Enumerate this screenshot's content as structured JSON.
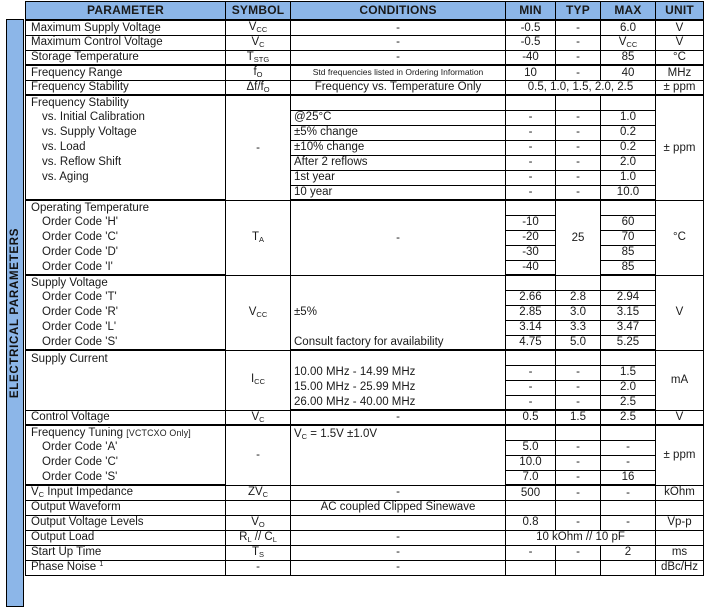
{
  "banner": {
    "label": "ELECTRICAL PARAMETERS"
  },
  "colors": {
    "header_fill": "#8cb6e8",
    "banner_fill": "#8cb6e8",
    "border": "#000000",
    "text": "#1a1a1a"
  },
  "columns": {
    "parameter": "PARAMETER",
    "symbol": "SYMBOL",
    "conditions": "CONDITIONS",
    "min": "MIN",
    "typ": "TYP",
    "max": "MAX",
    "unit": "UNIT"
  },
  "rows": {
    "max_supply_voltage": {
      "parameter": "Maximum Supply Voltage",
      "symbol_base": "V",
      "symbol_sub": "CC",
      "conditions": "-",
      "min": "-0.5",
      "typ": "-",
      "max": "6.0",
      "unit": "V"
    },
    "max_control_voltage": {
      "parameter": "Maximum Control Voltage",
      "symbol_base": "V",
      "symbol_sub": "C",
      "conditions": "-",
      "min": "-0.5",
      "typ": "-",
      "max_base": "V",
      "max_sub": "CC",
      "unit": "V"
    },
    "storage_temperature": {
      "parameter": "Storage Temperature",
      "symbol_base": "T",
      "symbol_sub": "STG",
      "conditions": "-",
      "min": "-40",
      "typ": "-",
      "max": "85",
      "unit": "°C"
    },
    "frequency_range": {
      "parameter": "Frequency Range",
      "symbol_base": "f",
      "symbol_sub": "O",
      "conditions": "Std frequencies listed in Ordering Information",
      "min": "10",
      "typ": "-",
      "max": "40",
      "unit": "MHz"
    },
    "frequency_stability": {
      "parameter": "Frequency Stability",
      "symbol": "Δf/f",
      "symbol_sub": "O",
      "conditions": "Frequency vs. Temperature Only",
      "value": "0.5, 1.0, 1.5, 2.0, 2.5",
      "unit": "± ppm"
    },
    "fstab_group": {
      "title": "Frequency Stability",
      "symbol": "-",
      "unit": "± ppm",
      "items": [
        {
          "parameter": "vs. Initial Calibration",
          "conditions": "@25°C",
          "min": "-",
          "typ": "-",
          "max": "1.0"
        },
        {
          "parameter": "vs. Supply Voltage",
          "conditions": "±5% change",
          "min": "-",
          "typ": "-",
          "max": "0.2"
        },
        {
          "parameter": "vs. Load",
          "conditions": "±10% change",
          "min": "-",
          "typ": "-",
          "max": "0.2"
        },
        {
          "parameter": "vs. Reflow Shift",
          "conditions": "After 2 reflows",
          "min": "-",
          "typ": "-",
          "max": "2.0"
        },
        {
          "parameter": "vs. Aging",
          "conditions": "1st year",
          "min": "-",
          "typ": "-",
          "max": "1.0"
        },
        {
          "parameter": "",
          "conditions": "10 year",
          "min": "-",
          "typ": "-",
          "max": "10.0"
        }
      ]
    },
    "optemp_group": {
      "title": "Operating Temperature",
      "symbol_base": "T",
      "symbol_sub": "A",
      "conditions": "-",
      "typ": "25",
      "unit": "°C",
      "items": [
        {
          "parameter": "Order Code 'H'",
          "min": "-10",
          "max": "60"
        },
        {
          "parameter": "Order Code 'C'",
          "min": "-20",
          "max": "70"
        },
        {
          "parameter": "Order Code 'D'",
          "min": "-30",
          "max": "85"
        },
        {
          "parameter": "Order Code 'I'",
          "min": "-40",
          "max": "85"
        }
      ]
    },
    "supplyv_group": {
      "title": "Supply Voltage",
      "symbol_base": "V",
      "symbol_sub": "CC",
      "conditions_1": "±5%",
      "conditions_2": "Consult factory for availability",
      "unit": "V",
      "items": [
        {
          "parameter": "Order Code 'T'",
          "min": "2.66",
          "typ": "2.8",
          "max": "2.94"
        },
        {
          "parameter": "Order Code 'R'",
          "min": "2.85",
          "typ": "3.0",
          "max": "3.15"
        },
        {
          "parameter": "Order Code 'L'",
          "min": "3.14",
          "typ": "3.3",
          "max": "3.47"
        },
        {
          "parameter": "Order Code 'S'",
          "min": "4.75",
          "typ": "5.0",
          "max": "5.25"
        }
      ]
    },
    "supplyc_group": {
      "title": "Supply Current",
      "symbol_base": "I",
      "symbol_sub": "CC",
      "unit": "mA",
      "items": [
        {
          "conditions": "10.00 MHz - 14.99 MHz",
          "min": "-",
          "typ": "-",
          "max": "1.5"
        },
        {
          "conditions": "15.00 MHz - 25.99 MHz",
          "min": "-",
          "typ": "-",
          "max": "2.0"
        },
        {
          "conditions": "26.00 MHz - 40.00 MHz",
          "min": "-",
          "typ": "-",
          "max": "2.5"
        }
      ]
    },
    "control_voltage": {
      "parameter": "Control Voltage",
      "symbol_base": "V",
      "symbol_sub": "C",
      "conditions": "-",
      "min": "0.5",
      "typ": "1.5",
      "max": "2.5",
      "unit": "V"
    },
    "ftune_group": {
      "title": "Frequency Tuning",
      "title_note": "[VCTCXO Only]",
      "symbol": "-",
      "conditions_head_a": "V",
      "conditions_head_sub": "C",
      "conditions_head_b": " = 1.5V ±1.0V",
      "unit": "± ppm",
      "items": [
        {
          "parameter": "Order Code 'A'",
          "min": "5.0",
          "typ": "-",
          "max": "-"
        },
        {
          "parameter": "Order Code 'C'",
          "min": "10.0",
          "typ": "-",
          "max": "-"
        },
        {
          "parameter": "Order Code 'S'",
          "min": "7.0",
          "typ": "-",
          "max": "16"
        }
      ]
    },
    "vc_input_impedance": {
      "parameter_base": "V",
      "parameter_sub": "C",
      "parameter_rest": " Input Impedance",
      "symbol_base": "ZV",
      "symbol_sub": "C",
      "conditions": "-",
      "min": "500",
      "typ": "-",
      "max": "-",
      "unit": "kOhm"
    },
    "output_waveform": {
      "parameter": "Output Waveform",
      "symbol": "",
      "conditions": "AC coupled Clipped Sinewave",
      "min": "",
      "typ": "",
      "max": "",
      "unit": ""
    },
    "output_voltage": {
      "parameter": "Output Voltage Levels",
      "symbol_base": "V",
      "symbol_sub": "O",
      "conditions": "",
      "min": "0.8",
      "typ": "-",
      "max": "-",
      "unit": "Vp-p"
    },
    "output_load": {
      "parameter": "Output Load",
      "symbol_a": "R",
      "symbol_a_sub": "L",
      "symbol_mid": " // ",
      "symbol_b": "C",
      "symbol_b_sub": "L",
      "conditions": "-",
      "value": "10 kOhm // 10 pF",
      "unit": ""
    },
    "start_up_time": {
      "parameter": "Start Up Time",
      "symbol_base": "T",
      "symbol_sub": "S",
      "conditions": "-",
      "min": "-",
      "typ": "-",
      "max": "2",
      "unit": "ms"
    },
    "phase_noise": {
      "parameter": "Phase Noise",
      "footnote": "1",
      "symbol": "-",
      "conditions": "-",
      "min": "",
      "typ": "",
      "max": "",
      "unit": "dBc/Hz"
    }
  }
}
